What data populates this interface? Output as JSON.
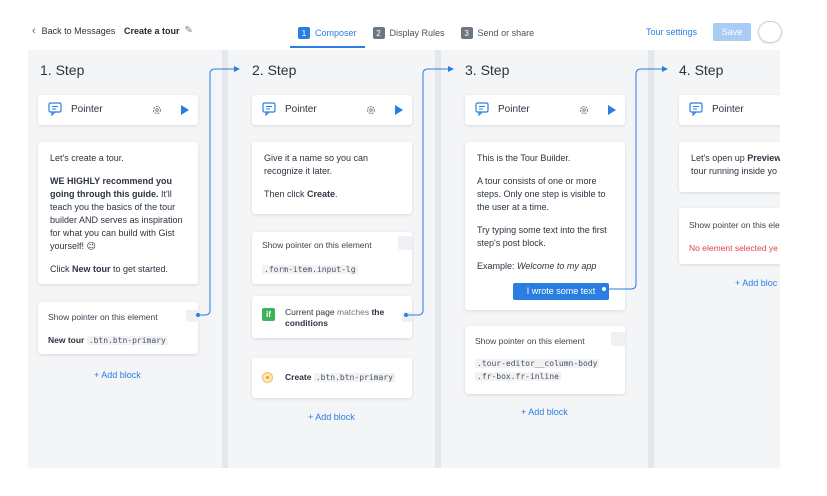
{
  "header": {
    "back_label": "Back to Messages",
    "tour_title": "Create a tour",
    "tabs": [
      {
        "num": "1",
        "label": "Composer"
      },
      {
        "num": "2",
        "label": "Display Rules"
      },
      {
        "num": "3",
        "label": "Send or share"
      }
    ],
    "tour_settings": "Tour settings",
    "save_label": "Save"
  },
  "common": {
    "pointer_label": "Pointer",
    "show_pointer": "Show pointer on this element",
    "add_block": "+ Add block"
  },
  "steps": [
    {
      "title": "1. Step",
      "intro": "Let's create a tour.",
      "bold_lead": "WE HIGHLY recommend you going through this guide.",
      "body": " It'll teach you the basics of the tour builder AND serves as inspiration for what you can build with Gist yourself! 😉",
      "click_prefix": "Click ",
      "click_bold": "New tour",
      "click_suffix": " to get started.",
      "element_name": "New tour",
      "element_selector": ".btn.btn-primary"
    },
    {
      "title": "2. Step",
      "line1": "Give it a name so you can recognize it later.",
      "then_prefix": "Then click ",
      "then_bold": "Create",
      "then_suffix": ".",
      "selector": ".form-item.input-lg",
      "condition_prefix": "Current page ",
      "condition_mid": "matches",
      "condition_bold": " the conditions",
      "if_badge": "if",
      "action_name": "Create",
      "action_selector": ".btn.btn-primary"
    },
    {
      "title": "3. Step",
      "line1": "This is the Tour Builder.",
      "line2": "A tour consists of one or more steps. Only one step is visible to the user at a time.",
      "line3": "Try typing some text into the first step's post block.",
      "example_prefix": "Example: ",
      "example_italic": "Welcome to my app",
      "button_label": "I wrote some text",
      "selector_line1": ".tour-editor__column-body",
      "selector_line2": ".fr-box.fr-inline"
    },
    {
      "title": "4. Step",
      "line1_prefix": "Let's open up ",
      "line1_bold": "Preview",
      "line2": "tour running inside yo",
      "show_pointer_cut": "Show pointer on this ele",
      "no_element": "No element selected ye",
      "add_block_cut": "+ Add bloc"
    }
  ],
  "colors": {
    "accent": "#2a7de1",
    "condition_green": "#3db357",
    "error_red": "#e0434b"
  }
}
